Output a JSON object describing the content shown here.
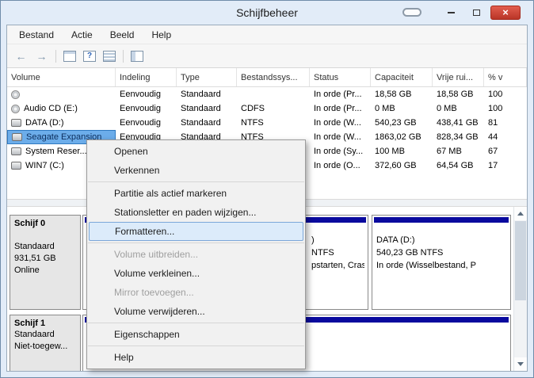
{
  "window": {
    "title": "Schijfbeheer"
  },
  "icons": {
    "close": "×"
  },
  "menubar": {
    "items": [
      "Bestand",
      "Actie",
      "Beeld",
      "Help"
    ]
  },
  "toolbar": {
    "back_glyph": "←",
    "forward_glyph": "→",
    "help_glyph": "?"
  },
  "volume_table": {
    "columns": [
      "Volume",
      "Indeling",
      "Type",
      "Bestandssys...",
      "Status",
      "Capaciteit",
      "Vrije rui...",
      "% v"
    ],
    "rows": [
      {
        "icon": "cd",
        "volume": "",
        "indeling": "Eenvoudig",
        "type": "Standaard",
        "fs": "",
        "status": "In orde (Pr...",
        "capaciteit": "18,58 GB",
        "vrije_ruimte": "18,58 GB",
        "pct": "100",
        "selected": false
      },
      {
        "icon": "cd",
        "volume": "Audio CD (E:)",
        "indeling": "Eenvoudig",
        "type": "Standaard",
        "fs": "CDFS",
        "status": "In orde (Pr...",
        "capaciteit": "0 MB",
        "vrije_ruimte": "0 MB",
        "pct": "100",
        "selected": false
      },
      {
        "icon": "drive",
        "volume": "DATA (D:)",
        "indeling": "Eenvoudig",
        "type": "Standaard",
        "fs": "NTFS",
        "status": "In orde (W...",
        "capaciteit": "540,23 GB",
        "vrije_ruimte": "438,41 GB",
        "pct": "81",
        "selected": false
      },
      {
        "icon": "drive",
        "volume": "Seagate Expansion",
        "indeling": "Eenvoudig",
        "type": "Standaard",
        "fs": "NTFS",
        "status": "In orde (W...",
        "capaciteit": "1863,02 GB",
        "vrije_ruimte": "828,34 GB",
        "pct": "44",
        "selected": true
      },
      {
        "icon": "drive",
        "volume": "System Reser...",
        "indeling": "",
        "type": "",
        "fs": "",
        "status": "In orde (Sy...",
        "capaciteit": "100 MB",
        "vrije_ruimte": "67 MB",
        "pct": "67",
        "selected": false
      },
      {
        "icon": "drive",
        "volume": "WIN7 (C:)",
        "indeling": "",
        "type": "",
        "fs": "",
        "status": "In orde (O...",
        "capaciteit": "372,60 GB",
        "vrije_ruimte": "64,54 GB",
        "pct": "17",
        "selected": false
      }
    ]
  },
  "context_menu": {
    "items": [
      {
        "label": "Openen",
        "enabled": true,
        "highlighted": false
      },
      {
        "label": "Verkennen",
        "enabled": true,
        "highlighted": false
      },
      {
        "label": "Partitie als actief markeren",
        "enabled": true,
        "highlighted": false
      },
      {
        "label": "Stationsletter en paden wijzigen...",
        "enabled": true,
        "highlighted": false
      },
      {
        "label": "Formatteren...",
        "enabled": true,
        "highlighted": true
      },
      {
        "label": "Volume uitbreiden...",
        "enabled": false,
        "highlighted": false
      },
      {
        "label": "Volume verkleinen...",
        "enabled": true,
        "highlighted": false
      },
      {
        "label": "Mirror toevoegen...",
        "enabled": false,
        "highlighted": false
      },
      {
        "label": "Volume verwijderen...",
        "enabled": true,
        "highlighted": false
      },
      {
        "label": "Eigenschappen",
        "enabled": true,
        "highlighted": false
      },
      {
        "label": "Help",
        "enabled": true,
        "highlighted": false
      }
    ]
  },
  "graph": {
    "disks": [
      {
        "name": "Schijf 0",
        "layout": "Standaard",
        "size": "931,51 GB",
        "status": "Online",
        "partitions": [
          {
            "label": ")",
            "size": "NTFS",
            "status": "pstarten, Cras"
          },
          {
            "label": "DATA (D:)",
            "size": "540,23 GB NTFS",
            "status": "In orde (Wisselbestand, P"
          }
        ]
      },
      {
        "name": "Schijf 1",
        "layout": "Standaard",
        "size": "Niet-toegew...",
        "status": "",
        "partitions": [
          {
            "label": "",
            "size": "",
            "status": ""
          }
        ]
      }
    ]
  },
  "colors": {
    "selection_bg": "#6cadea",
    "partition_stripe": "#0a0a9e",
    "close_button": "#e25d4e"
  }
}
